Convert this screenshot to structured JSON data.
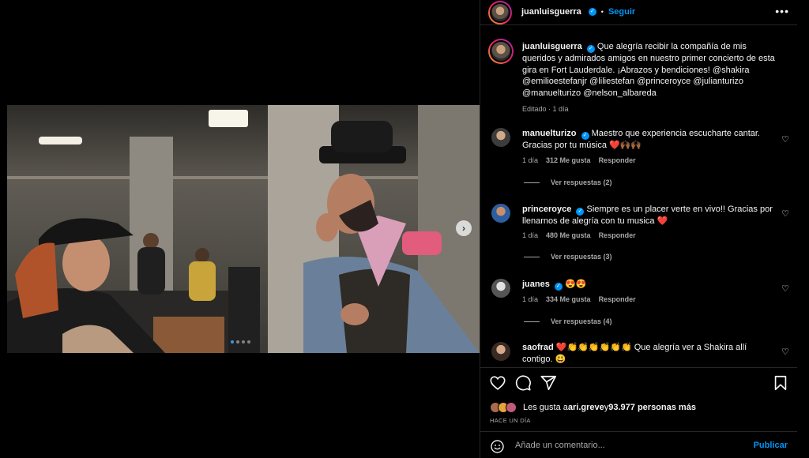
{
  "post": {
    "author": "juanluisguerra",
    "follow_label": "Seguir",
    "caption": "Que alegría recibir la compañía de mis queridos y admirados amigos en nuestro primer concierto de esta gira en Fort Lauderdale. ¡Abrazos y bendiciones! @shakira @emilioestefanjr @liliestefan @princeroyce @julianturizo @manuelturizo @nelson_albareda",
    "caption_meta": "Editado · 1 día"
  },
  "comments": [
    {
      "user": "manuelturizo",
      "verified": true,
      "text": "Maestro que experiencia escucharte cantar. Gracias por tu música ❤️🙌🏾🙌🏾",
      "time": "1 día",
      "likes": "312 Me gusta",
      "reply": "Responder",
      "replies": "Ver respuestas (2)"
    },
    {
      "user": "princeroyce",
      "verified": true,
      "text": "Siempre es un placer verte en vivo!! Gracias por llenarnos de alegría con tu musica ❤️",
      "time": "1 día",
      "likes": "480 Me gusta",
      "reply": "Responder",
      "replies": "Ver respuestas (3)"
    },
    {
      "user": "juanes",
      "verified": true,
      "text": "😍😍",
      "time": "1 día",
      "likes": "334 Me gusta",
      "reply": "Responder",
      "replies": "Ver respuestas (4)"
    },
    {
      "user": "saofrad",
      "verified": false,
      "text": "❤️👏👏👏👏👏👏 Que alegría ver a Shakira allí contigo. 😃",
      "time": "",
      "likes": "",
      "reply": "",
      "replies": ""
    }
  ],
  "likes_summary": {
    "prefix": "Les gusta a ",
    "user": "ari.greve",
    "middle": " y ",
    "count": "93.977 personas más"
  },
  "date_label": "HACE UN DÍA",
  "add_comment": {
    "placeholder": "Añade un comentario...",
    "post_label": "Publicar"
  },
  "carousel": {
    "slides": 4,
    "active": 0,
    "next_glyph": "›"
  },
  "colors": {
    "accent": "#0095f6",
    "heart": "#ed4956",
    "muted": "#a8a8a8",
    "divider": "#262626"
  }
}
